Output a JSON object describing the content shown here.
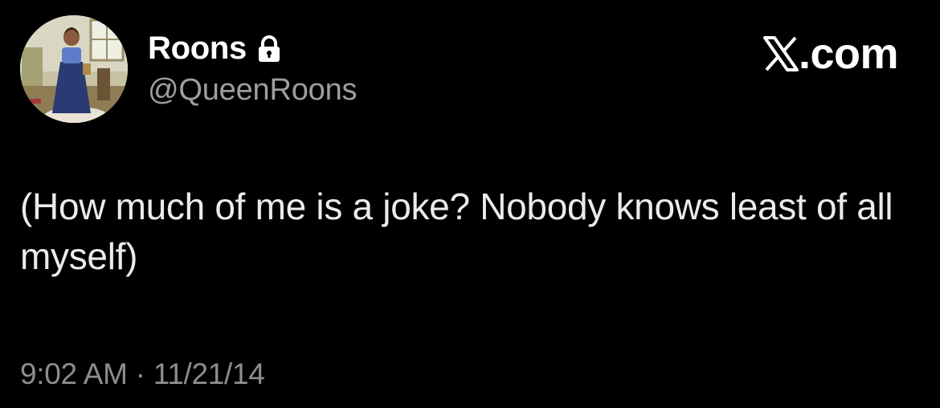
{
  "user": {
    "display_name": "Roons",
    "handle": "@QueenRoons",
    "protected_icon": "lock-icon",
    "avatar_icon": "avatar"
  },
  "brand": {
    "logo_icon": "x-logo-icon",
    "text": ".com"
  },
  "tweet": {
    "text": "(How much of me is a joke? Nobody knows least of all myself)",
    "time": "9:02 AM",
    "separator": "·",
    "date": "11/21/14"
  },
  "colors": {
    "background": "#000000",
    "primary_text": "#ffffff",
    "secondary_text": "#8b8d90"
  }
}
